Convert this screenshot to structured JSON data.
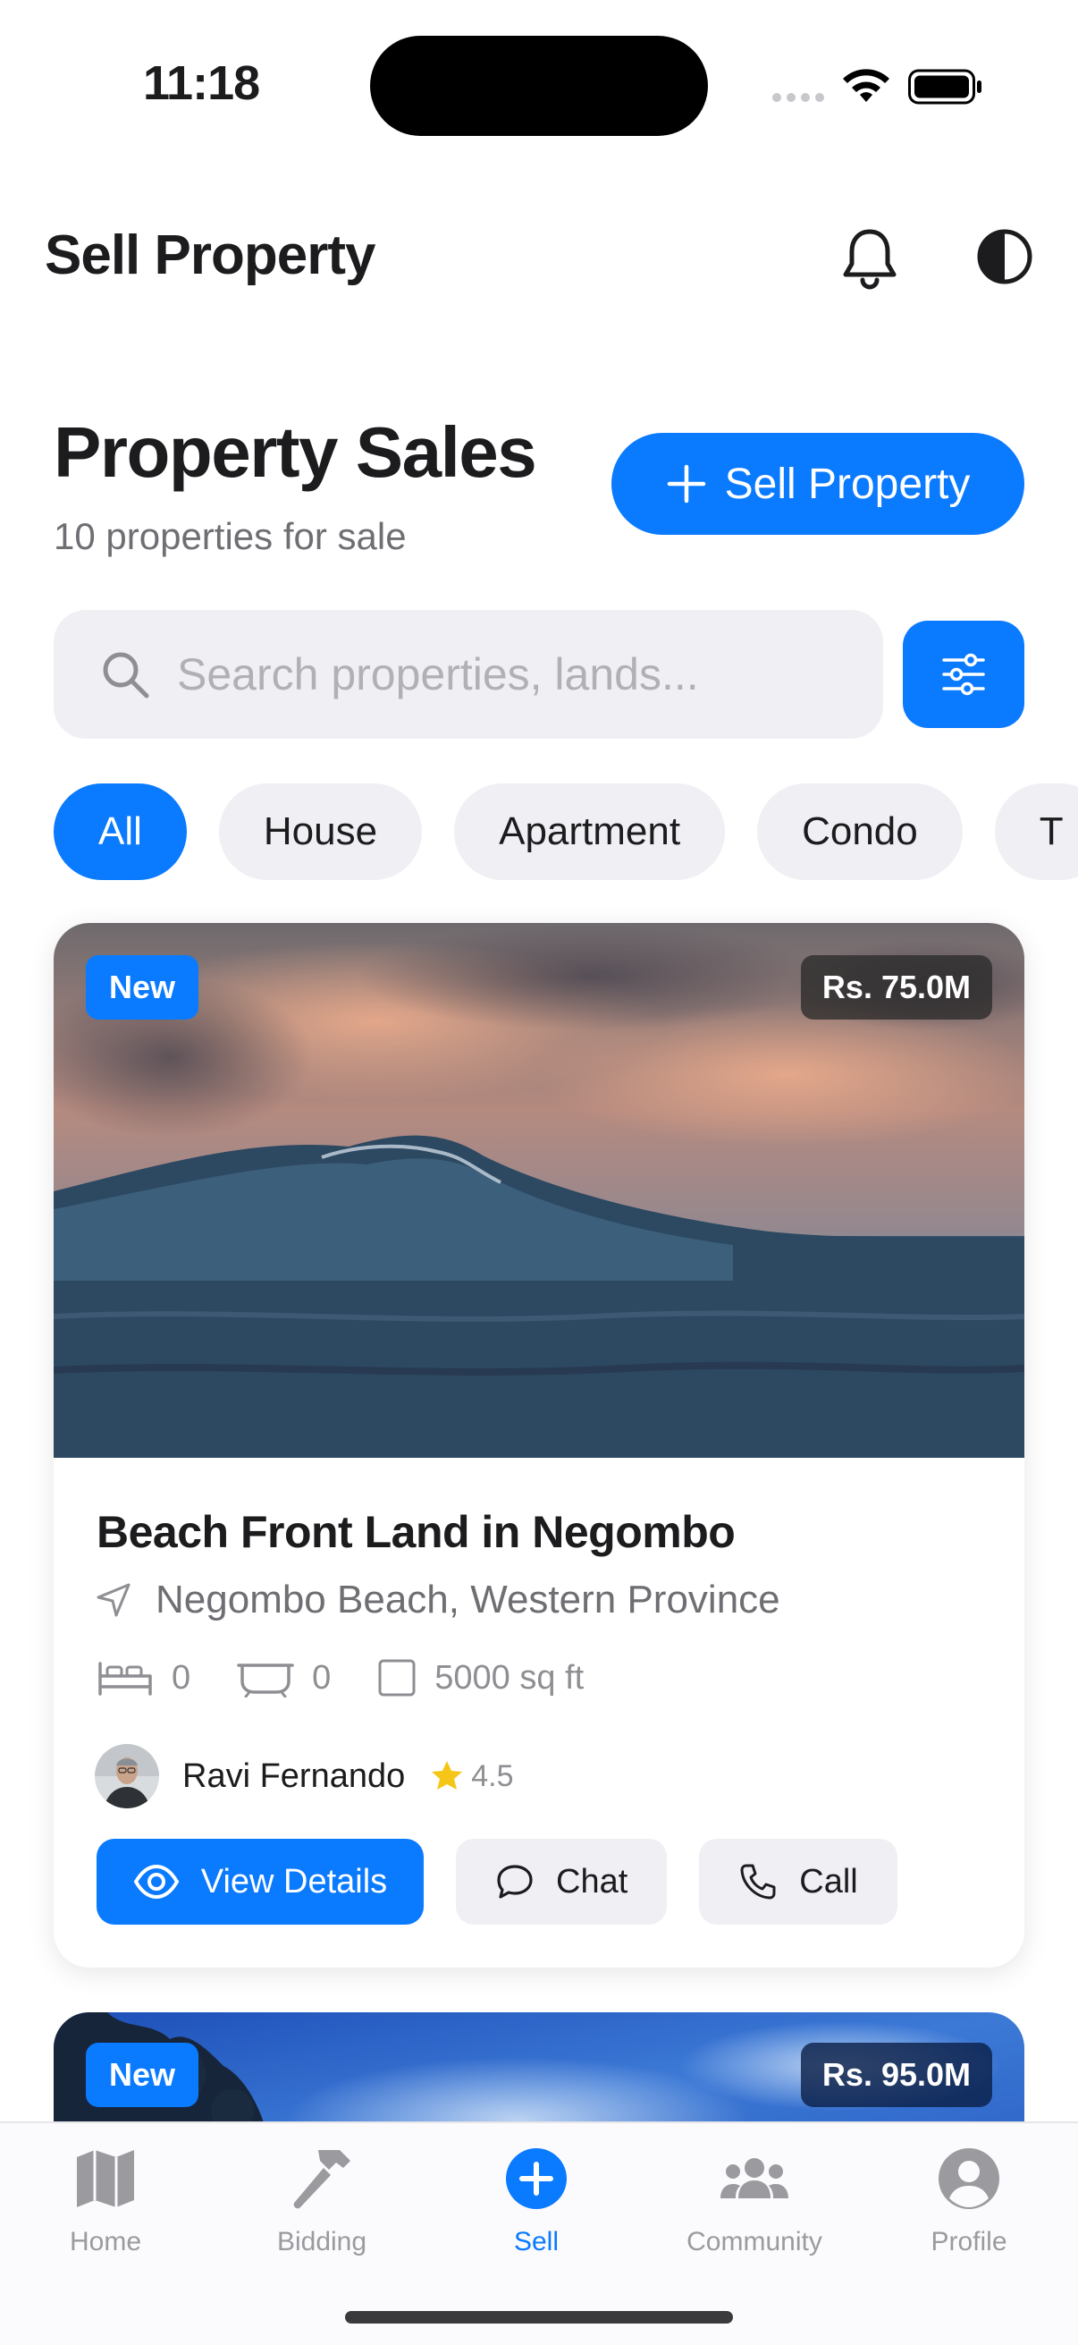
{
  "status_bar": {
    "time": "11:18"
  },
  "app_bar": {
    "title": "Sell Property"
  },
  "header": {
    "title": "Property Sales",
    "subtitle": "10 properties for sale",
    "sell_button_label": "Sell Property"
  },
  "search": {
    "placeholder": "Search properties, lands..."
  },
  "filters": [
    "All",
    "House",
    "Apartment",
    "Condo",
    "T"
  ],
  "active_filter": "All",
  "listing": {
    "badge": "New",
    "price": "Rs. 75.0M",
    "title": "Beach Front Land in Negombo",
    "location": "Negombo Beach, Western Province",
    "beds": "0",
    "baths": "0",
    "area": "5000 sq ft",
    "agent_name": "Ravi Fernando",
    "rating": "4.5",
    "actions": {
      "view": "View Details",
      "chat": "Chat",
      "call": "Call"
    }
  },
  "listing_next": {
    "badge": "New",
    "price": "Rs. 95.0M"
  },
  "tab_bar": {
    "items": [
      {
        "label": "Home",
        "icon": "map-icon"
      },
      {
        "label": "Bidding",
        "icon": "hammer-icon"
      },
      {
        "label": "Sell",
        "icon": "plus-circle-icon"
      },
      {
        "label": "Community",
        "icon": "people-icon"
      },
      {
        "label": "Profile",
        "icon": "person-circle-icon"
      }
    ],
    "active": "Sell"
  },
  "colors": {
    "accent": "#0a7aff",
    "text": "#1c1c1e",
    "muted": "#6e6e73",
    "surface": "#f0f0f4",
    "star": "#f5c518"
  }
}
